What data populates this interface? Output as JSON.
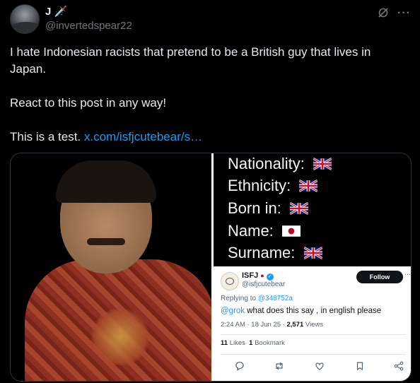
{
  "author": {
    "name": "J",
    "name_emoji": "🗡️",
    "handle": "@invertedspear22"
  },
  "header_icons": {
    "grok": "grok-icon",
    "more": "···"
  },
  "post": {
    "line1": "I hate Indonesian racists that pretend to be a British guy that lives in Japan.",
    "line2": "React to this post in any way!",
    "line3_text": "This is a test.",
    "line3_link": "x.com/isfjcutebear/s…"
  },
  "facts": [
    {
      "label": "Nationality:",
      "flag": "uk"
    },
    {
      "label": "Ethnicity:",
      "flag": "uk"
    },
    {
      "label": "Born in:",
      "flag": "uk"
    },
    {
      "label": "Name:",
      "flag": "japan"
    },
    {
      "label": "Surname:",
      "flag": "uk"
    }
  ],
  "reply_card": {
    "name": "ISFJ",
    "dot": "●",
    "handle": "@isfjcutebear",
    "follow_label": "Follow",
    "more": "···",
    "replying_prefix": "Replying to",
    "replying_to": "@348752a",
    "mention": "@grok",
    "text": "what does this say , in english please",
    "time": "2:24 AM · 18 Jun 25 · ",
    "views_count": "2,571",
    "views_label": "Views",
    "likes_count": "11",
    "likes_label": "Likes",
    "bookmarks_count": "1",
    "bookmarks_label": "Bookmark"
  },
  "colors": {
    "link": "#1d9bf0",
    "background": "#000000",
    "text": "#e7e9ea",
    "muted": "#71767b"
  }
}
